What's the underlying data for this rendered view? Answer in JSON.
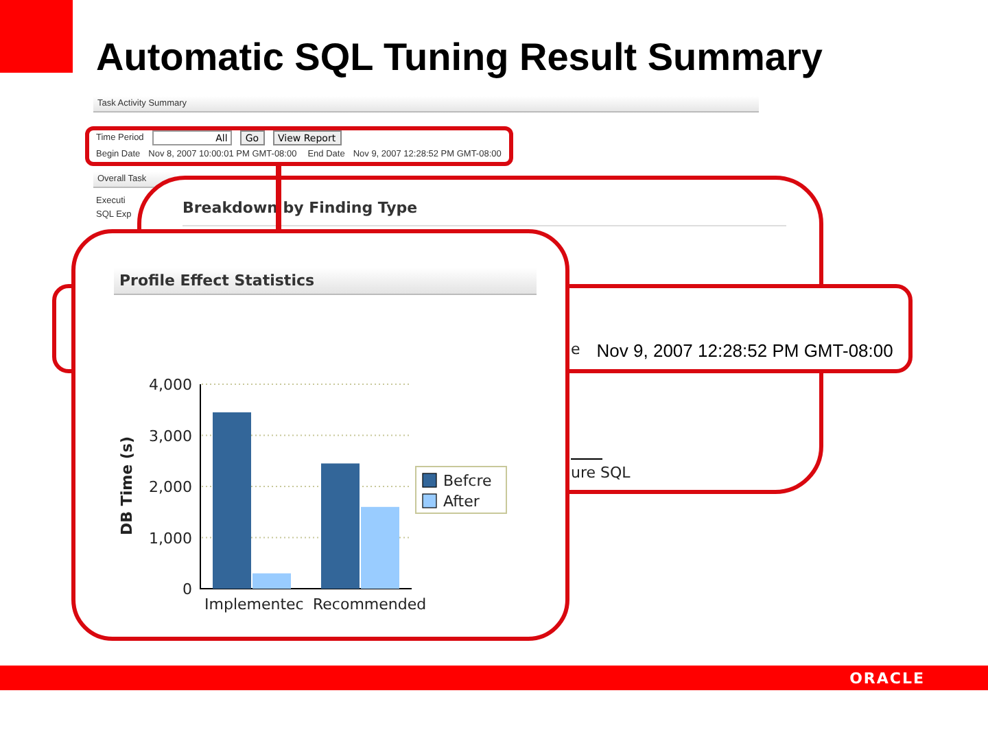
{
  "slide": {
    "title": "Automatic SQL Tuning Result Summary",
    "footer_logo": "ORACLE"
  },
  "background_screen": {
    "section_title": "Task Activity Summary",
    "time_period_label": "Time Period",
    "time_period_value": "All",
    "go_button": "Go",
    "view_report_button": "View Report",
    "begin_date_label": "Begin Date",
    "begin_date_value": "Nov 8, 2007 10:00:01 PM GMT-08:00",
    "end_date_label": "End Date",
    "end_date_value": "Nov 9, 2007 12:28:52 PM GMT-08:00",
    "overall_section_title": "Overall Task",
    "row_labels": [
      "Executi",
      "SQL Exp"
    ]
  },
  "breakdown_callout": {
    "title": "Breakdown by Finding Type",
    "fragment": "ure SQL"
  },
  "date_callout": {
    "label_fragment": "e",
    "value": "Nov 9, 2007 12:28:52 PM GMT-08:00"
  },
  "profile_callout": {
    "title": "Profile Effect Statistics",
    "chart_data": {
      "type": "bar",
      "ylabel": "DB Time (s)",
      "categories": [
        "Implementec",
        "Recommended"
      ],
      "series": [
        {
          "name": "Befcre",
          "color": "#336699",
          "values": [
            3450,
            2450
          ]
        },
        {
          "name": "After",
          "color": "#99ccff",
          "values": [
            300,
            1600
          ]
        }
      ],
      "ylim": [
        0,
        4000
      ],
      "grid": true,
      "legend": true,
      "yticks": [
        {
          "value": 0,
          "label": "0"
        },
        {
          "value": 1000,
          "label": "1,000"
        },
        {
          "value": 2000,
          "label": "2,000"
        },
        {
          "value": 3000,
          "label": "3,000"
        },
        {
          "value": 4000,
          "label": "4,000"
        }
      ]
    }
  }
}
